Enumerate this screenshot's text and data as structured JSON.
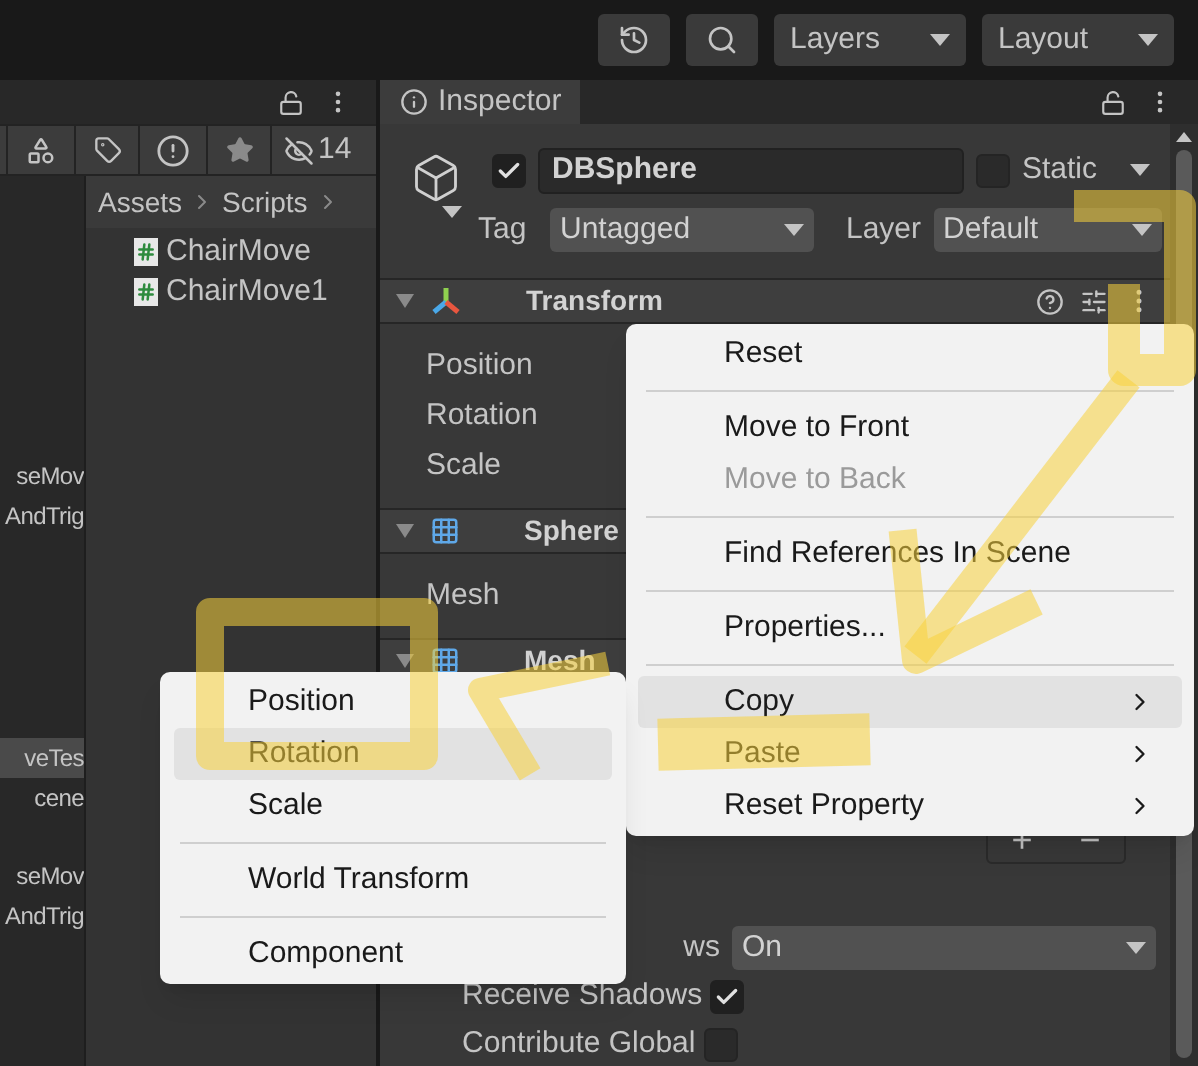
{
  "toolbar": {
    "layers": "Layers",
    "layout": "Layout"
  },
  "project": {
    "hidden_count": "14",
    "breadcrumb": [
      "Assets",
      "Scripts"
    ],
    "files": [
      "ChairMove",
      "ChairMove1"
    ],
    "hierarchy_items": [
      {
        "label": "seMov",
        "selected": false
      },
      {
        "label": "AndTrig",
        "selected": false
      },
      {
        "label": "veTes",
        "selected": true
      },
      {
        "label": "cene",
        "selected": false
      },
      {
        "label": "seMov",
        "selected": false
      },
      {
        "label": "AndTrig",
        "selected": false
      }
    ]
  },
  "inspector": {
    "title": "Inspector",
    "object": {
      "active": true,
      "name": "DBSphere",
      "static": false,
      "static_label": "Static",
      "tag_label": "Tag",
      "tag": "Untagged",
      "layer_label": "Layer",
      "layer": "Default"
    },
    "components": [
      {
        "kind": "transform",
        "title": "Transform",
        "fields": [
          "Position",
          "Rotation",
          "Scale"
        ]
      },
      {
        "kind": "mesh",
        "title": "Sphere",
        "fields": [
          "Mesh"
        ]
      },
      {
        "kind": "mesh",
        "title": "Mesh"
      }
    ],
    "add_button": "+",
    "remove_button": "−",
    "cast_shadows": {
      "label": "ws",
      "value": "On"
    },
    "receive_shadows": {
      "label": "Receive Shadows",
      "checked": true
    },
    "contribute_global": {
      "label": "Contribute Global",
      "checked": false
    }
  },
  "context_menu": {
    "groups": [
      [
        {
          "label": "Reset",
          "disabled": false,
          "submenu": false,
          "selected": false
        }
      ],
      [
        {
          "label": "Move to Front",
          "disabled": false,
          "submenu": false,
          "selected": false
        },
        {
          "label": "Move to Back",
          "disabled": true,
          "submenu": false,
          "selected": false
        }
      ],
      [
        {
          "label": "Find References In Scene",
          "disabled": false,
          "submenu": false,
          "selected": false
        }
      ],
      [
        {
          "label": "Properties...",
          "disabled": false,
          "submenu": false,
          "selected": false
        }
      ],
      [
        {
          "label": "Copy",
          "disabled": false,
          "submenu": true,
          "selected": true
        },
        {
          "label": "Paste",
          "disabled": false,
          "submenu": true,
          "selected": false
        },
        {
          "label": "Reset Property",
          "disabled": false,
          "submenu": true,
          "selected": false
        }
      ]
    ]
  },
  "submenu": {
    "groups": [
      [
        {
          "label": "Position",
          "selected": false
        },
        {
          "label": "Rotation",
          "selected": true
        },
        {
          "label": "Scale",
          "selected": false
        }
      ],
      [
        {
          "label": "World Transform",
          "selected": false
        }
      ],
      [
        {
          "label": "Component",
          "selected": false
        }
      ]
    ]
  }
}
